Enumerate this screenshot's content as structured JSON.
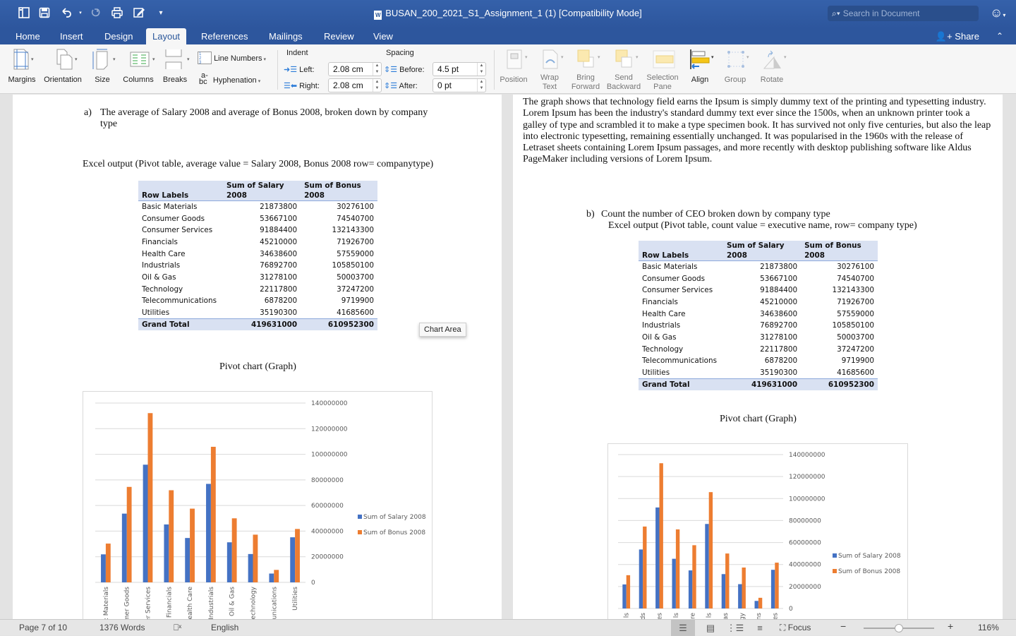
{
  "window": {
    "title": "BUSAN_200_2021_S1_Assignment_1 (1) [Compatibility Mode]",
    "search_placeholder": "Search in Document",
    "quick_access": [
      "sidebar-toggle-icon",
      "save-icon",
      "undo-icon",
      "redo-icon",
      "print-icon",
      "edit-icon",
      "customize-icon"
    ]
  },
  "tabs": [
    {
      "label": "Home"
    },
    {
      "label": "Insert"
    },
    {
      "label": "Design"
    },
    {
      "label": "Layout",
      "active": true
    },
    {
      "label": "References"
    },
    {
      "label": "Mailings"
    },
    {
      "label": "Review"
    },
    {
      "label": "View"
    }
  ],
  "share_label": "Share",
  "ribbon": {
    "margins": "Margins",
    "orientation": "Orientation",
    "size": "Size",
    "columns": "Columns",
    "breaks": "Breaks",
    "line_numbers": "Line Numbers",
    "hyphenation": "Hyphenation",
    "indent_heading": "Indent",
    "spacing_heading": "Spacing",
    "left_label": "Left:",
    "right_label": "Right:",
    "before_label": "Before:",
    "after_label": "After:",
    "left_value": "2.08 cm",
    "right_value": "2.08 cm",
    "before_value": "4.5 pt",
    "after_value": "0 pt",
    "position": "Position",
    "wrap_text": [
      "Wrap",
      "Text"
    ],
    "bring_forward": [
      "Bring",
      "Forward"
    ],
    "send_backward": [
      "Send",
      "Backward"
    ],
    "selection_pane": [
      "Selection",
      "Pane"
    ],
    "align": "Align",
    "group": "Group",
    "rotate": "Rotate"
  },
  "left_page": {
    "item_a_marker": "a)",
    "item_a_text": "The average of Salary 2008 and average of Bonus 2008, broken down by company type",
    "excel_output": "Excel output (Pivot table, average value = Salary 2008, Bonus 2008 row= companytype)",
    "pivot_chart_title": "Pivot chart (Graph)"
  },
  "right_page": {
    "paragraph": "The graph shows that technology field earns the Ipsum is simply dummy text of the printing and typesetting industry. Lorem Ipsum has been the industry's standard dummy text ever since the 1500s, when an unknown printer took a galley of type and scrambled it to make a type specimen book. It has survived not only five centuries, but also the leap into electronic typesetting, remaining essentially unchanged. It was popularised in the 1960s with the release of Letraset sheets containing Lorem Ipsum passages, and more recently with desktop publishing software like Aldus PageMaker including versions of Lorem Ipsum.",
    "item_b_marker": "b)",
    "item_b_text": "Count the number of CEO broken down by company type",
    "excel_output": "Excel output (Pivot table, count value = executive name, row= company type)",
    "pivot_chart_title": "Pivot chart (Graph)"
  },
  "pivot_table": {
    "headers": [
      "Row Labels",
      "Sum of Salary 2008",
      "Sum of Bonus 2008"
    ],
    "header_lines": [
      [
        "",
        "Sum of Salary",
        "Sum of Bonus"
      ],
      [
        "Row Labels",
        "2008",
        "2008"
      ]
    ],
    "rows": [
      [
        "Basic Materials",
        "21873800",
        "30276100"
      ],
      [
        "Consumer Goods",
        "53667100",
        "74540700"
      ],
      [
        "Consumer Services",
        "91884400",
        "132143300"
      ],
      [
        "Financials",
        "45210000",
        "71926700"
      ],
      [
        "Health Care",
        "34638600",
        "57559000"
      ],
      [
        "Industrials",
        "76892700",
        "105850100"
      ],
      [
        "Oil & Gas",
        "31278100",
        "50003700"
      ],
      [
        "Technology",
        "22117800",
        "37247200"
      ],
      [
        "Telecommunications",
        "6878200",
        "9719900"
      ],
      [
        "Utilities",
        "35190300",
        "41685600"
      ]
    ],
    "total": [
      "Grand Total",
      "419631000",
      "610952300"
    ]
  },
  "tooltip": "Chart Area",
  "chart_data": [
    {
      "type": "bar",
      "categories": [
        "Basic Materials",
        "Consumer Goods",
        "Consumer Services",
        "Financials",
        "Health Care",
        "Industrials",
        "Oil & Gas",
        "Technology",
        "Telecommunications",
        "Utilities"
      ],
      "visible_tick_labels": [
        ": Materials",
        "mer Goods",
        "er Services",
        "Financials",
        "ealth Care",
        "Industrials",
        "Oil & Gas",
        "echnology",
        "unications",
        "Utilities"
      ],
      "series": [
        {
          "name": "Sum of Salary 2008",
          "color": "#4472c4",
          "values": [
            21873800,
            53667100,
            91884400,
            45210000,
            34638600,
            76892700,
            31278100,
            22117800,
            6878200,
            35190300
          ]
        },
        {
          "name": "Sum of Bonus 2008",
          "color": "#ed7d31",
          "values": [
            30276100,
            74540700,
            132143300,
            71926700,
            57559000,
            105850100,
            50003700,
            37247200,
            9719900,
            41685600
          ]
        }
      ],
      "y_ticks": [
        "0",
        "20000000",
        "40000000",
        "60000000",
        "80000000",
        "100000000",
        "120000000",
        "140000000"
      ],
      "ylim": [
        0,
        140000000
      ],
      "y_axis_side": "right",
      "grid": true,
      "legend": "right",
      "title": "",
      "xlabel": "",
      "ylabel": ""
    },
    {
      "type": "bar",
      "categories": [
        "Basic Materials",
        "Consumer Goods",
        "Consumer Services",
        "Financials",
        "Health Care",
        "Industrials",
        "Oil & Gas",
        "Technology",
        "Telecommunications",
        "Utilities"
      ],
      "visible_tick_labels": [
        "ls",
        "ds",
        "es",
        "ls",
        "re",
        "ls",
        "as",
        "gy",
        "ns",
        "es"
      ],
      "series": [
        {
          "name": "Sum of Salary 2008",
          "color": "#4472c4",
          "values": [
            21873800,
            53667100,
            91884400,
            45210000,
            34638600,
            76892700,
            31278100,
            22117800,
            6878200,
            35190300
          ]
        },
        {
          "name": "Sum of Bonus 2008",
          "color": "#ed7d31",
          "values": [
            30276100,
            74540700,
            132143300,
            71926700,
            57559000,
            105850100,
            50003700,
            37247200,
            9719900,
            41685600
          ]
        }
      ],
      "y_ticks": [
        "0",
        "20000000",
        "40000000",
        "60000000",
        "80000000",
        "100000000",
        "120000000",
        "140000000"
      ],
      "ylim": [
        0,
        140000000
      ],
      "y_axis_side": "right",
      "grid": true,
      "legend": "right",
      "title": "",
      "xlabel": "",
      "ylabel": ""
    }
  ],
  "status": {
    "page": "Page 7 of 10",
    "words": "1376 Words",
    "language": "English",
    "focus": "Focus",
    "zoom": "116%",
    "zoom_fraction": 0.5
  }
}
